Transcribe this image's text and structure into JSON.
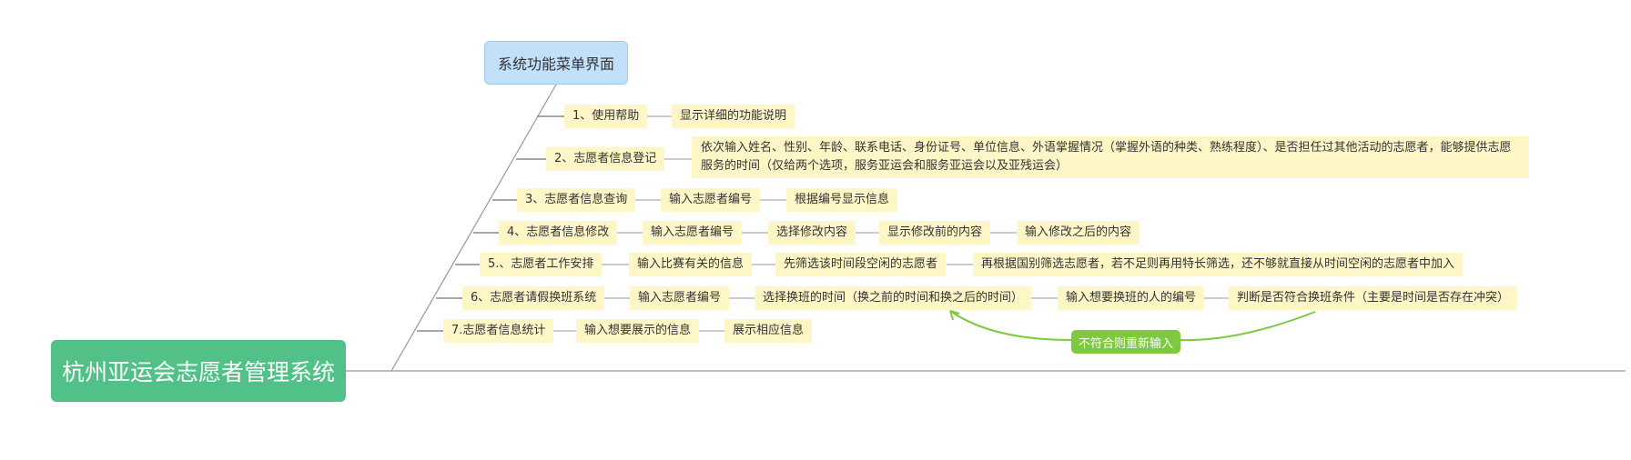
{
  "central_topic": "杭州亚运会志愿者管理系统",
  "menu_topic": "系统功能菜单界面",
  "branches": [
    {
      "label": "1、使用帮助",
      "children": [
        "显示详细的功能说明"
      ]
    },
    {
      "label": "2、志愿者信息登记",
      "children": [
        "依次输入姓名、性别、年龄、联系电话、身份证号、单位信息、外语掌握情况（掌握外语的种类、熟练程度）、是否担任过其他活动的志愿者，能够提供志愿服务的时间（仅给两个选项，服务亚运会和服务亚运会以及亚残运会）"
      ]
    },
    {
      "label": "3、志愿者信息查询",
      "children": [
        "输入志愿者编号",
        "根据编号显示信息"
      ]
    },
    {
      "label": "4、志愿者信息修改",
      "children": [
        "输入志愿者编号",
        "选择修改内容",
        "显示修改前的内容",
        "输入修改之后的内容"
      ]
    },
    {
      "label": "5.、志愿者工作安排",
      "children": [
        "输入比赛有关的信息",
        "先筛选该时间段空闲的志愿者",
        "再根据国别筛选志愿者，若不足则再用特长筛选，还不够就直接从时间空闲的志愿者中加入"
      ]
    },
    {
      "label": "6、志愿者请假换班系统",
      "children": [
        "输入志愿者编号",
        "选择换班的时间（换之前的时间和换之后的时间）",
        "输入想要换班的人的编号",
        "判断是否符合换班条件（主要是时间是否存在冲突）"
      ]
    },
    {
      "label": "7.志愿者信息统计",
      "children": [
        "输入想要展示的信息",
        "展示相应信息"
      ]
    }
  ],
  "relationship_label": "不符合则重新输入",
  "colors": {
    "central": "#52c187",
    "menu": "#c3e0fa",
    "node": "#fff6c8",
    "line": "#999999",
    "relationship": "#7ec93f"
  }
}
